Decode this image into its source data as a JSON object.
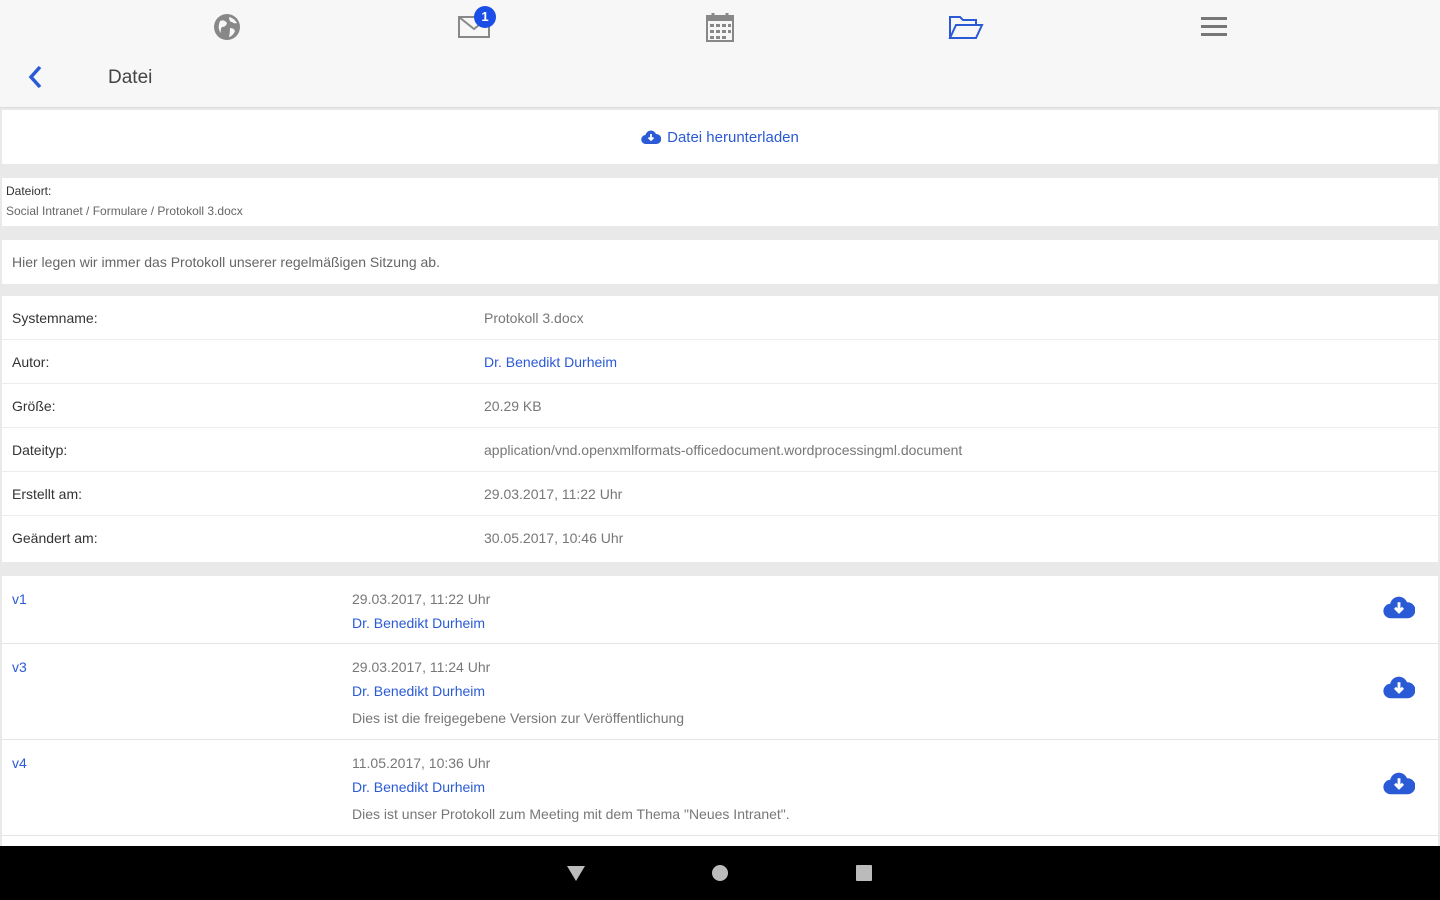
{
  "nav": {
    "icons": [
      "globe-icon",
      "mail-icon",
      "calendar-icon",
      "folder-open-icon",
      "menu-icon"
    ],
    "mail_badge": "1",
    "accent": "#1a4ee6"
  },
  "header": {
    "title": "Datei"
  },
  "download": {
    "label": "Datei herunterladen"
  },
  "location": {
    "label": "Dateiort:",
    "path": "Social Intranet / Formulare / Protokoll 3.docx"
  },
  "description": "Hier legen wir immer das Protokoll unserer regelmäßigen Sitzung ab.",
  "properties": [
    {
      "key": "Systemname:",
      "value": "Protokoll 3.docx"
    },
    {
      "key": "Autor:",
      "value": "Dr. Benedikt Durheim"
    },
    {
      "key": "Größe:",
      "value": "20.29 KB"
    },
    {
      "key": "Dateityp:",
      "value": "application/vnd.openxmlformats-officedocument.wordprocessingml.document"
    },
    {
      "key": "Erstellt am:",
      "value": "29.03.2017, 11:22 Uhr"
    },
    {
      "key": "Geändert am:",
      "value": "30.05.2017, 10:46 Uhr"
    }
  ],
  "versions": [
    {
      "id": "v1",
      "date": "29.03.2017, 11:22 Uhr",
      "author": "Dr. Benedikt Durheim",
      "note": ""
    },
    {
      "id": "v3",
      "date": "29.03.2017, 11:24 Uhr",
      "author": "Dr. Benedikt Durheim",
      "note": "Dies ist die freigegebene Version zur Veröffentlichung"
    },
    {
      "id": "v4",
      "date": "11.05.2017, 10:36 Uhr",
      "author": "Dr. Benedikt Durheim",
      "note": "Dies ist unser Protokoll zum Meeting mit dem Thema \"Neues Intranet\"."
    }
  ]
}
